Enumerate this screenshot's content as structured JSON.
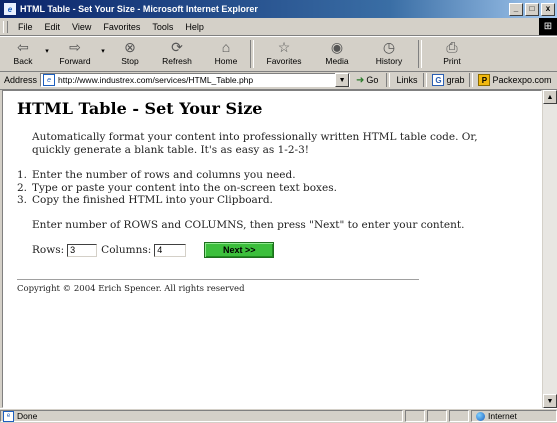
{
  "window": {
    "title": "HTML Table - Set Your Size - Microsoft Internet Explorer",
    "controls": {
      "minimize": "_",
      "maximize": "□",
      "close": "x"
    }
  },
  "menu": [
    "File",
    "Edit",
    "View",
    "Favorites",
    "Tools",
    "Help"
  ],
  "toolbar": {
    "back": "Back",
    "forward": "Forward",
    "stop": "Stop",
    "refresh": "Refresh",
    "home": "Home",
    "favorites": "Favorites",
    "media": "Media",
    "history": "History",
    "print": "Print"
  },
  "address": {
    "label": "Address",
    "url": "http://www.industrex.com/services/HTML_Table.php",
    "go": "Go",
    "links_label": "Links",
    "links": [
      {
        "icon": "G",
        "label": "grab"
      },
      {
        "icon": "P",
        "label": "Packexpo.com"
      }
    ]
  },
  "page": {
    "heading": "HTML Table - Set Your Size",
    "intro": "Automatically format your content into professionally written HTML table code. Or, quickly generate a blank table. It's as easy as 1-2-3!",
    "steps": [
      {
        "num": "1.",
        "text": "Enter the number of rows and columns you need."
      },
      {
        "num": "2.",
        "text": "Type or paste your content into the on-screen text boxes."
      },
      {
        "num": "3.",
        "text": "Copy the finished HTML into your Clipboard."
      }
    ],
    "instructions": "Enter number of ROWS and COLUMNS, then press \"Next\" to enter your content.",
    "form": {
      "rows_label": "Rows:",
      "rows_value": "3",
      "columns_label": "Columns:",
      "columns_value": "4",
      "next_label": "Next >>",
      "next_color": "#3cbf3c"
    },
    "copyright": "Copyright © 2004 Erich Spencer. All rights reserved"
  },
  "status": {
    "text": "Done",
    "zone": "Internet"
  }
}
